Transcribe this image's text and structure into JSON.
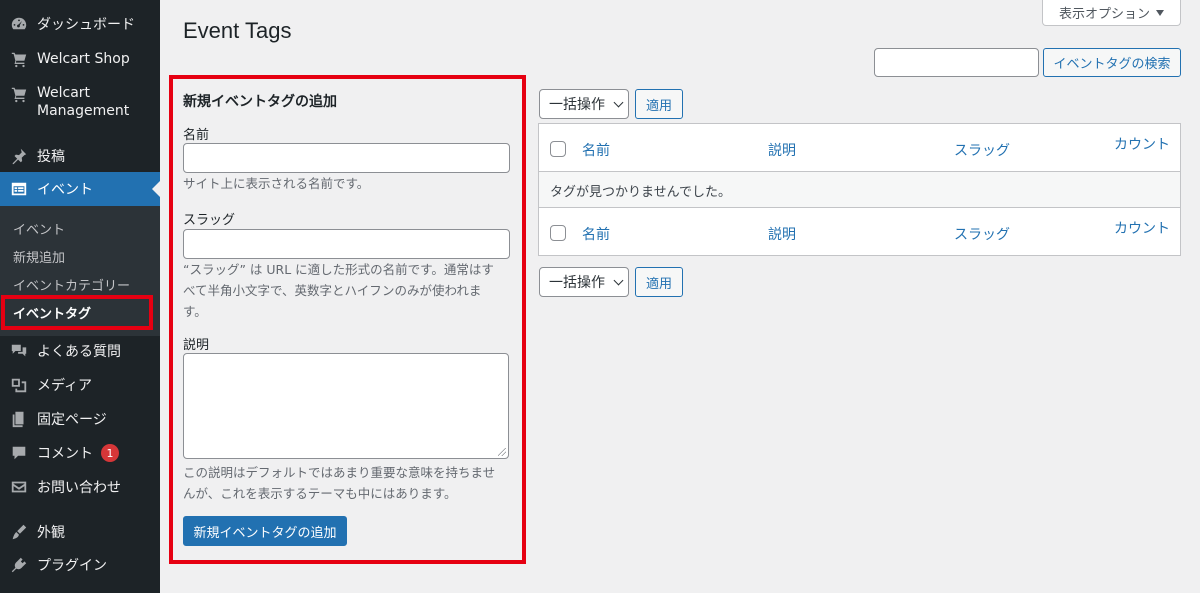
{
  "sidebar": {
    "items": [
      {
        "label": "ダッシュボード",
        "icon": "dashboard-icon"
      },
      {
        "label": "Welcart Shop",
        "icon": "cart-icon"
      },
      {
        "label": "Welcart\nManagement",
        "icon": "cart-icon"
      },
      {
        "label": "投稿",
        "icon": "pin-icon"
      },
      {
        "label": "イベント",
        "icon": "calendar-list-icon"
      },
      {
        "label": "よくある質問",
        "icon": "comments-icon"
      },
      {
        "label": "メディア",
        "icon": "media-icon"
      },
      {
        "label": "固定ページ",
        "icon": "page-icon"
      },
      {
        "label": "コメント",
        "icon": "comment-icon",
        "badge": "1"
      },
      {
        "label": "お問い合わせ",
        "icon": "mail-icon"
      },
      {
        "label": "外観",
        "icon": "brush-icon"
      },
      {
        "label": "プラグイン",
        "icon": "plugin-icon"
      }
    ],
    "submenu": [
      "イベント",
      "新規追加",
      "イベントカテゴリー",
      "イベントタグ"
    ]
  },
  "header": {
    "title": "Event Tags",
    "screen_options": "表示オプション"
  },
  "search": {
    "value": "",
    "button": "イベントタグの検索"
  },
  "form": {
    "heading": "新規イベントタグの追加",
    "name_label": "名前",
    "name_help": "サイト上に表示される名前です。",
    "slug_label": "スラッグ",
    "slug_help_1": "“スラッグ” は URL に適した形式の名前です。通常はす",
    "slug_help_2": "べて半角小文字で、英数字とハイフンのみが使われま",
    "slug_help_3": "す。",
    "desc_label": "説明",
    "desc_help_1": "この説明はデフォルトではあまり重要な意味を持ちませ",
    "desc_help_2": "んが、これを表示するテーマも中にはあります。",
    "submit": "新規イベントタグの追加"
  },
  "bulk": {
    "select": "一括操作",
    "apply": "適用"
  },
  "table": {
    "columns": [
      "名前",
      "説明",
      "スラッグ",
      "カウント"
    ],
    "empty": "タグが見つかりませんでした。"
  },
  "colors": {
    "sidebar_bg": "#1d2327",
    "accent": "#2271b1",
    "highlight": "#e60012"
  }
}
